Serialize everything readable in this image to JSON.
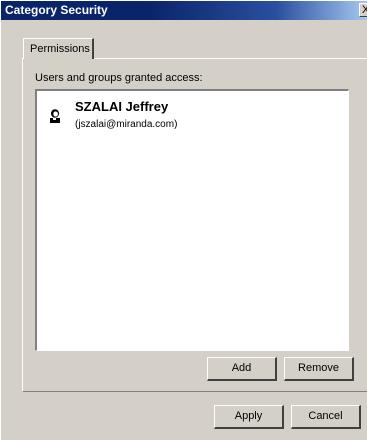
{
  "window": {
    "title": "Category Security",
    "close_glyph": "X"
  },
  "tabs": [
    {
      "label": "Permissions"
    }
  ],
  "permissions": {
    "users_label": "Users and groups granted access:",
    "users": [
      {
        "name": "SZALAI Jeffrey",
        "email": "(jszalai@miranda.com)",
        "icon": "user-icon"
      }
    ],
    "add_label": "Add",
    "remove_label": "Remove"
  },
  "footer": {
    "apply_label": "Apply",
    "cancel_label": "Cancel"
  }
}
